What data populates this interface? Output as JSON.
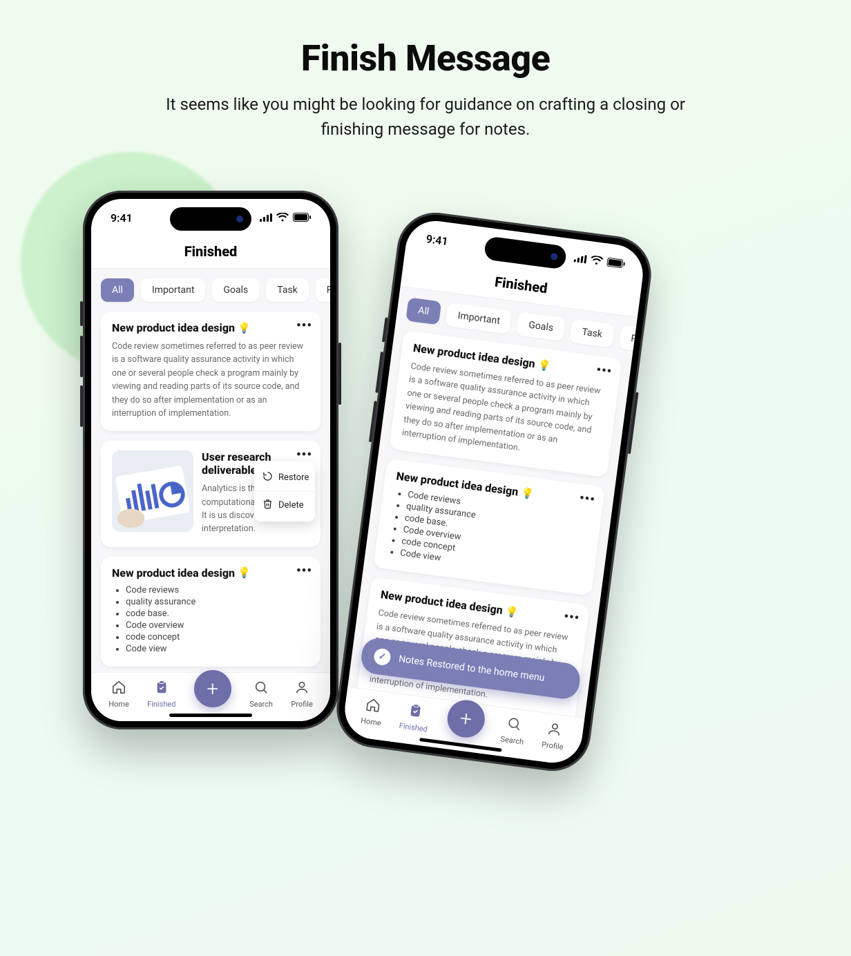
{
  "hero": {
    "title": "Finish Message",
    "subtitle": "It seems like you might be looking for guidance on crafting a closing or finishing message for notes."
  },
  "status": {
    "time": "9:41"
  },
  "page_title": "Finished",
  "chips": {
    "all": "All",
    "important": "Important",
    "goals": "Goals",
    "task": "Task",
    "product": "Produc"
  },
  "cards": {
    "c1": {
      "title": "New product idea design",
      "body": "Code review sometimes referred to as peer review is a software quality assurance activity in which one or several people check a program mainly by viewing and reading parts of its source code, and they do so after implementation or as an interruption of implementation."
    },
    "c2": {
      "title": "User research deliverables",
      "body": "Analytics is the computational a statistics. It is us discovery, interpretation."
    },
    "c3": {
      "title": "New product idea design",
      "items": [
        "Code reviews",
        "quality assurance",
        "code base.",
        "Code overview",
        "code concept",
        "Code view"
      ]
    }
  },
  "popup": {
    "restore": "Restore",
    "delete": "Delete"
  },
  "toast": {
    "text": "Notes Restored to the home menu"
  },
  "nav": {
    "home": "Home",
    "finished": "Finished",
    "search": "Search",
    "profile": "Profile"
  }
}
